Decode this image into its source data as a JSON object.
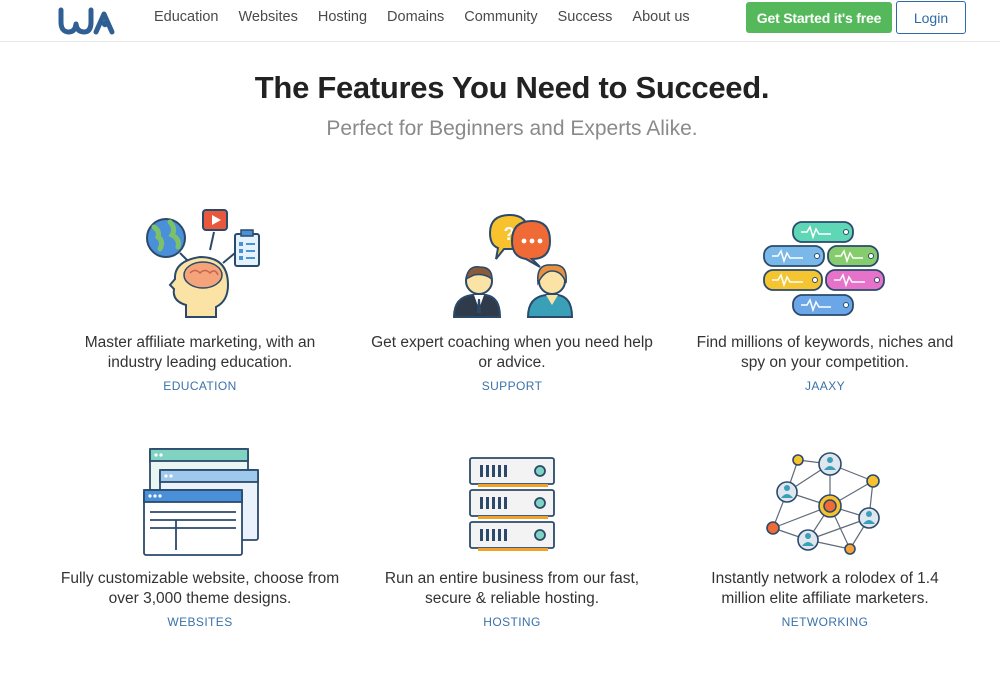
{
  "header": {
    "nav": [
      "Education",
      "Websites",
      "Hosting",
      "Domains",
      "Community",
      "Success",
      "About us"
    ],
    "get_started": "Get Started it's free",
    "login": "Login"
  },
  "hero": {
    "title": "The Features You Need to Succeed.",
    "subtitle": "Perfect for Beginners and Experts Alike."
  },
  "features": [
    {
      "text_line1": "Master affiliate marketing, with an",
      "text_line2": "industry leading education.",
      "link": "EDUCATION",
      "icon": "brain-education-icon"
    },
    {
      "text_line1": "Get expert coaching when you need help",
      "text_line2": "or advice.",
      "link": "SUPPORT",
      "icon": "coaching-chat-icon"
    },
    {
      "text_line1": "Find millions of keywords, niches and",
      "text_line2": "spy on your competition.",
      "link": "JAAXY",
      "icon": "keyword-tags-icon"
    },
    {
      "text_line1": "Fully customizable website, choose from",
      "text_line2": "over 3,000 theme designs.",
      "link": "WEBSITES",
      "icon": "website-windows-icon"
    },
    {
      "text_line1": "Run an entire business from our fast,",
      "text_line2": "secure & reliable hosting.",
      "link": "HOSTING",
      "icon": "server-stack-icon"
    },
    {
      "text_line1": "Instantly network a rolodex of 1.4",
      "text_line2": "million elite affiliate marketers.",
      "link": "NETWORKING",
      "icon": "network-graph-icon"
    }
  ],
  "colors": {
    "accent_green": "#55b85a",
    "link_blue": "#3a72a8",
    "login_blue": "#2e6aa8"
  }
}
